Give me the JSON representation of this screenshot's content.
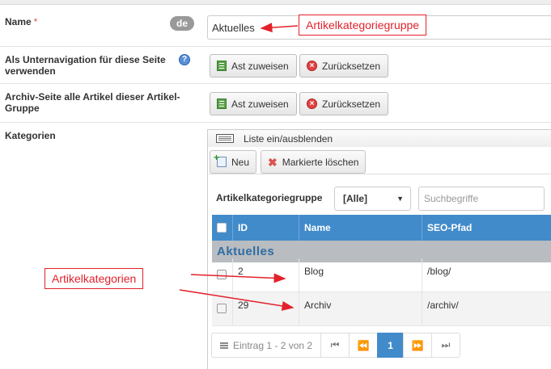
{
  "form": {
    "name_label": "Name",
    "required_marker": "*",
    "lang_badge": "de",
    "name_value": "Aktuelles",
    "subnav_label": "Als Unternavigation für diese Seite verwenden",
    "archive_label": "Archiv-Seite alle Artikel dieser Artikel-Gruppe",
    "categories_label": "Kategorien",
    "assign_label": "Ast zuweisen",
    "reset_label": "Zurücksetzen",
    "help_icon": "?"
  },
  "panel": {
    "toggle_label": "Liste ein/ausblenden"
  },
  "toolbar": {
    "new_label": "Neu",
    "delete_label": "Markierte löschen"
  },
  "filter": {
    "label": "Artikelkategoriegruppe",
    "selected": "[Alle]",
    "search_placeholder": "Suchbegriffe"
  },
  "table": {
    "headers": [
      "ID",
      "Name",
      "SEO-Pfad"
    ],
    "group": "Aktuelles",
    "rows": [
      {
        "id": "2",
        "name": "Blog",
        "seo": "/blog/"
      },
      {
        "id": "29",
        "name": "Archiv",
        "seo": "/archiv/"
      }
    ]
  },
  "pager": {
    "info": "Eintrag 1 - 2 von 2",
    "current_page": "1",
    "first_icon": "first-page-icon",
    "prev_icon": "prev-page-icon",
    "next_icon": "next-page-icon",
    "last_icon": "last-page-icon"
  },
  "annotations": {
    "group_note": "Artikelkategoriegruppe",
    "categories_note": "Artikelkategorien"
  },
  "colors": {
    "header_blue": "#428bca",
    "annotation_red": "#e3212b"
  }
}
